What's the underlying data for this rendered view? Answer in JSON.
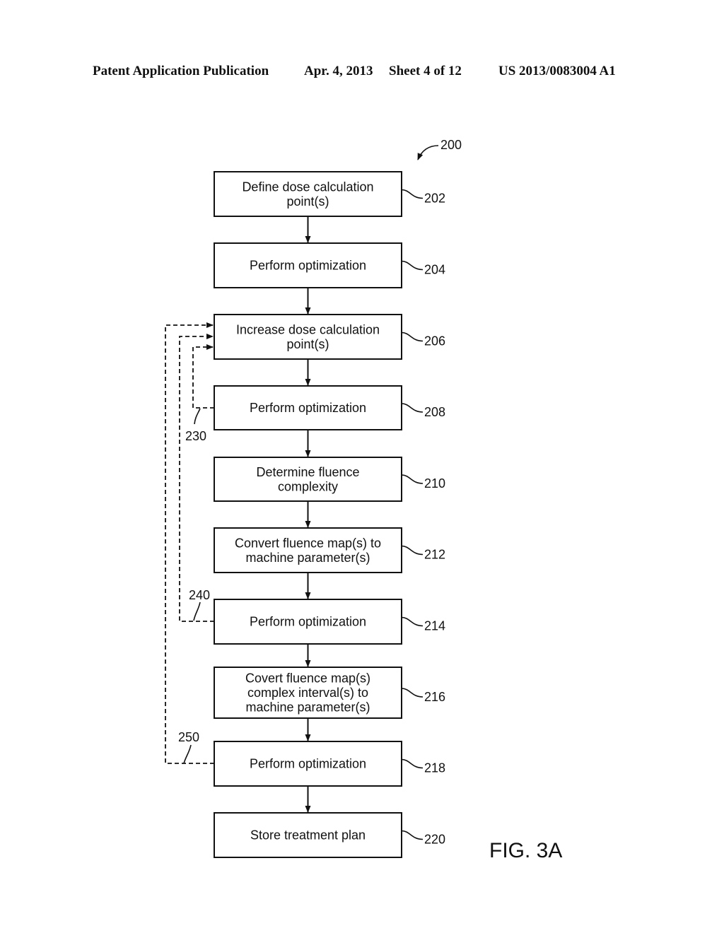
{
  "header": {
    "publication": "Patent Application Publication",
    "date": "Apr. 4, 2013",
    "sheet": "Sheet 4 of 12",
    "number": "US 2013/0083004 A1"
  },
  "figure": {
    "label": "FIG. 3A",
    "ref": "200",
    "steps": [
      {
        "ref": "202",
        "lines": [
          "Define dose calculation",
          "point(s)"
        ]
      },
      {
        "ref": "204",
        "lines": [
          "Perform optimization"
        ]
      },
      {
        "ref": "206",
        "lines": [
          "Increase dose calculation",
          "point(s)"
        ]
      },
      {
        "ref": "208",
        "lines": [
          "Perform optimization"
        ]
      },
      {
        "ref": "210",
        "lines": [
          "Determine fluence",
          "complexity"
        ]
      },
      {
        "ref": "212",
        "lines": [
          "Convert fluence map(s) to",
          "machine parameter(s)"
        ]
      },
      {
        "ref": "214",
        "lines": [
          "Perform optimization"
        ]
      },
      {
        "ref": "216",
        "lines": [
          "Covert fluence map(s)",
          "complex interval(s) to",
          "machine parameter(s)"
        ]
      },
      {
        "ref": "218",
        "lines": [
          "Perform optimization"
        ]
      },
      {
        "ref": "220",
        "lines": [
          "Store treatment plan"
        ]
      }
    ],
    "loops": [
      {
        "ref": "230",
        "from": "208",
        "to": "206"
      },
      {
        "ref": "240",
        "from": "214",
        "to": "206"
      },
      {
        "ref": "250",
        "from": "218",
        "to": "206"
      }
    ]
  }
}
